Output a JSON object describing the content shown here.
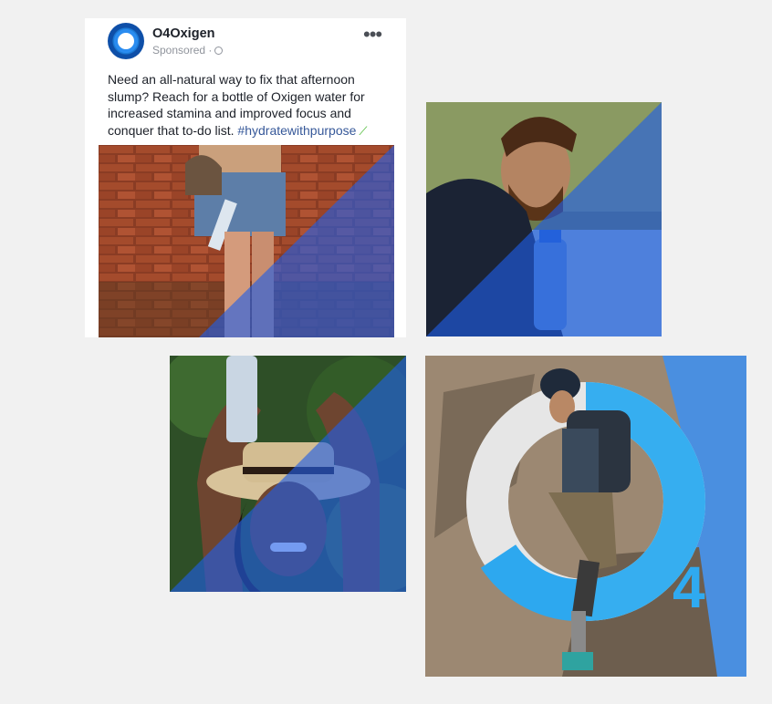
{
  "ad": {
    "brand_name": "O4Oxigen",
    "sponsored_label": "Sponsored ·",
    "more_icon": "more-options-icon",
    "body_text": "Need an all-natural way to fix that afternoon slump? Reach for a bottle of Oxigen water for increased stamina and improved focus and conquer that to-do list.",
    "hashtag": "#hydratewithpurpose",
    "trend_icon": "trending-icon",
    "photo_description": "woman-brick-wall-photo"
  },
  "tiles": {
    "beard_man": "man-with-bottle-photo",
    "hat_woman": "woman-hat-bottle-photo",
    "climber": "rock-climber-photo",
    "climber_number": "4"
  },
  "colors": {
    "brand_blue": "#1c7bd6",
    "overlay_blue": "#1e5de8",
    "accent_cyan": "#2faaf0",
    "hashtag": "#365899"
  }
}
